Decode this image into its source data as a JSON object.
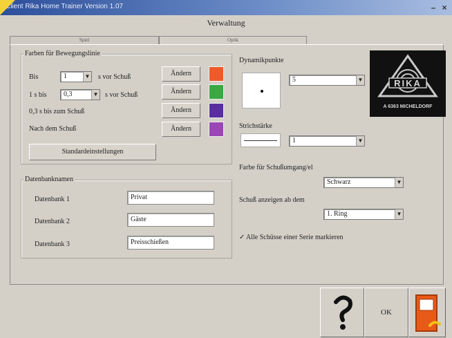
{
  "window": {
    "title": "Client Rika Home Trainer Version 1.07",
    "minimize_label": "–",
    "close_label": "×"
  },
  "heading": "Verwaltung",
  "tabs": [
    {
      "label": "Spiel",
      "active": false
    },
    {
      "label": "Optik",
      "active": true
    }
  ],
  "colors_group": {
    "title": "Farben für Bewegungslinie",
    "rows": [
      {
        "prefix": "Bis",
        "value": "1",
        "suffix": "s vor Schuß",
        "button": "Ändern",
        "color": "#f05a28"
      },
      {
        "prefix": "1 s bis",
        "value": "0,3",
        "suffix": "s vor Schuß",
        "button": "Ändern",
        "color": "#3aa843"
      },
      {
        "prefix": "0,3 s bis zum Schuß",
        "button": "Ändern",
        "color": "#5a2ea0"
      },
      {
        "prefix": "Nach dem Schuß",
        "button": "Ändern",
        "color": "#9a46b4"
      }
    ],
    "defaults_button": "Standardeinstellungen"
  },
  "db_group": {
    "title": "Datenbanknamen",
    "rows": [
      {
        "label": "Datenbank 1",
        "value": "Privat"
      },
      {
        "label": "Datenbank 2",
        "value": "Gäste"
      },
      {
        "label": "Datenbank 3",
        "value": "Preisschießen"
      }
    ]
  },
  "right": {
    "dynamic_label": "Dynamikpunkte",
    "dynamic_value": "5",
    "line_label": "Strichstärke",
    "line_value": "1",
    "color_label": "Farbe für Schußumgang/el",
    "color_value": "Schwarz",
    "show_label": "Schuß anzeigen ab dem",
    "show_value": "1. Ring",
    "checkbox_label": "Alle Schüsse einer Serie markieren",
    "checkbox_checked": true
  },
  "logo": {
    "brand": "RIKA",
    "caption": "A 6363 MICHELDORF"
  },
  "bottom": {
    "ok_label": "OK"
  }
}
